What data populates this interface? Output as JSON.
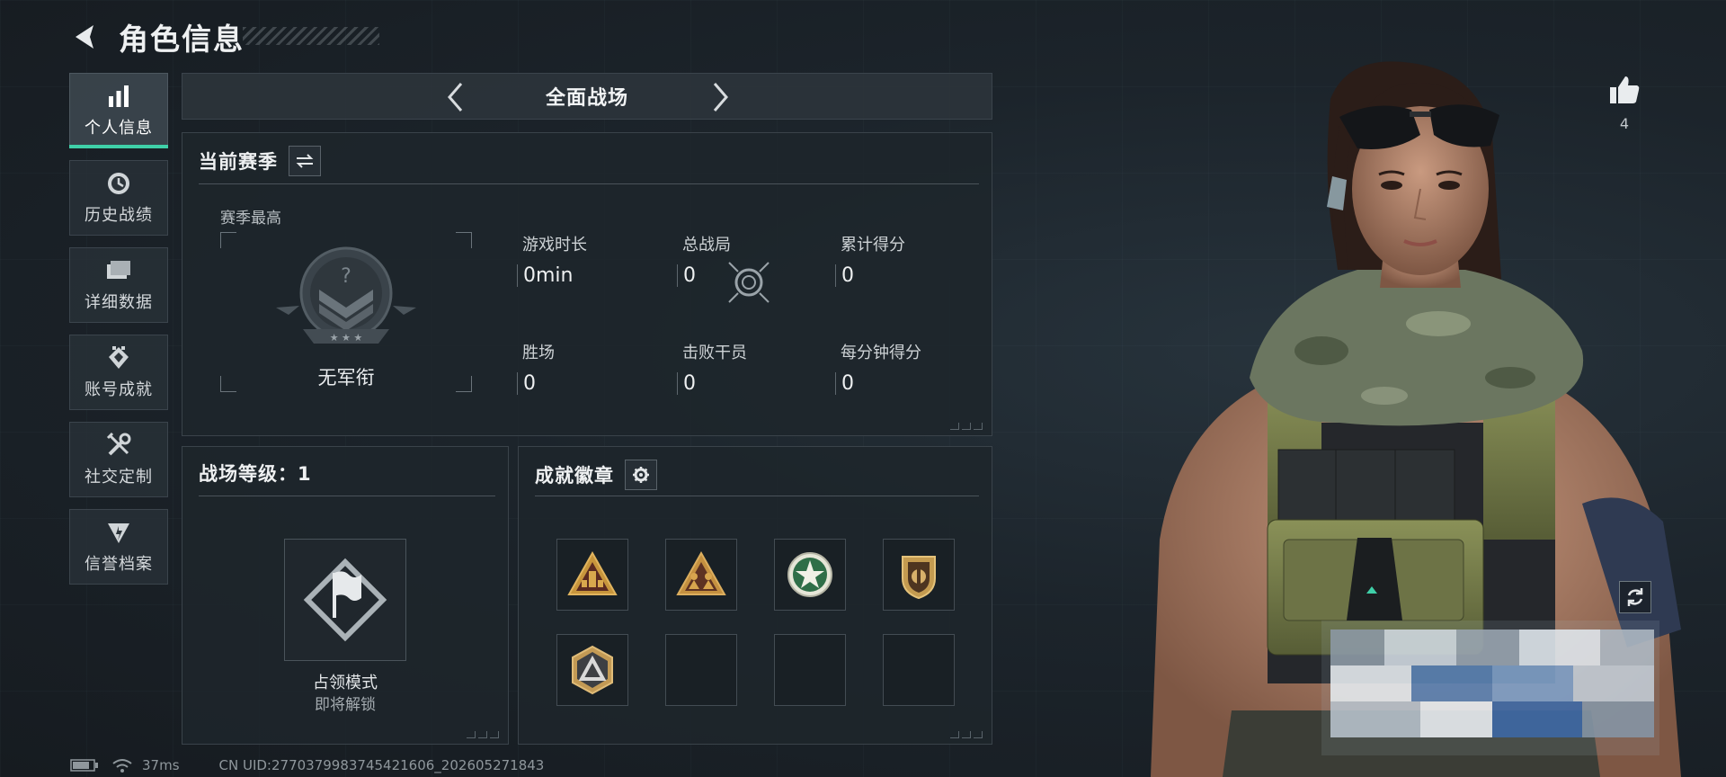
{
  "header": {
    "title": "角色信息"
  },
  "sidebar": {
    "items": [
      {
        "label": "个人信息",
        "icon": "bar-chart-icon",
        "active": true
      },
      {
        "label": "历史战绩",
        "icon": "history-clock-icon",
        "active": false
      },
      {
        "label": "详细数据",
        "icon": "folder-icon",
        "active": false
      },
      {
        "label": "账号成就",
        "icon": "achievement-icon",
        "active": false
      },
      {
        "label": "社交定制",
        "icon": "tools-icon",
        "active": false
      },
      {
        "label": "信誉档案",
        "icon": "credit-shield-icon",
        "active": false
      }
    ]
  },
  "mode": {
    "name": "全面战场"
  },
  "season": {
    "title": "当前赛季",
    "subtitle": "赛季最高",
    "rank_name": "无军衔",
    "stats": [
      {
        "label": "游戏时长",
        "value": "0min"
      },
      {
        "label": "总战局",
        "value": "0"
      },
      {
        "label": "累计得分",
        "value": "0"
      },
      {
        "label": "胜场",
        "value": "0"
      },
      {
        "label": "击败干员",
        "value": "0"
      },
      {
        "label": "每分钟得分",
        "value": "0"
      }
    ]
  },
  "level": {
    "title": "战场等级：1",
    "mode_name": "占领模式",
    "mode_status": "即将解锁"
  },
  "badges": {
    "title": "成就徽章",
    "slots": [
      {
        "icon": "triangle-tower-badge-icon",
        "filled": true
      },
      {
        "icon": "triangle-soldiers-badge-icon",
        "filled": true
      },
      {
        "icon": "green-star-badge-icon",
        "filled": true
      },
      {
        "icon": "gold-shield-badge-icon",
        "filled": true
      },
      {
        "icon": "hexagon-triangle-badge-icon",
        "filled": true
      },
      {
        "icon": "",
        "filled": false
      },
      {
        "icon": "",
        "filled": false
      },
      {
        "icon": "",
        "filled": false
      }
    ]
  },
  "character": {
    "likes": "4"
  },
  "footer": {
    "ping": "37ms",
    "uid": "CN UID:2770379983745421606_202605271843"
  },
  "colors": {
    "accent": "#3fd0a8",
    "panel_bg": "#1e252b",
    "border": "#3a434a"
  }
}
